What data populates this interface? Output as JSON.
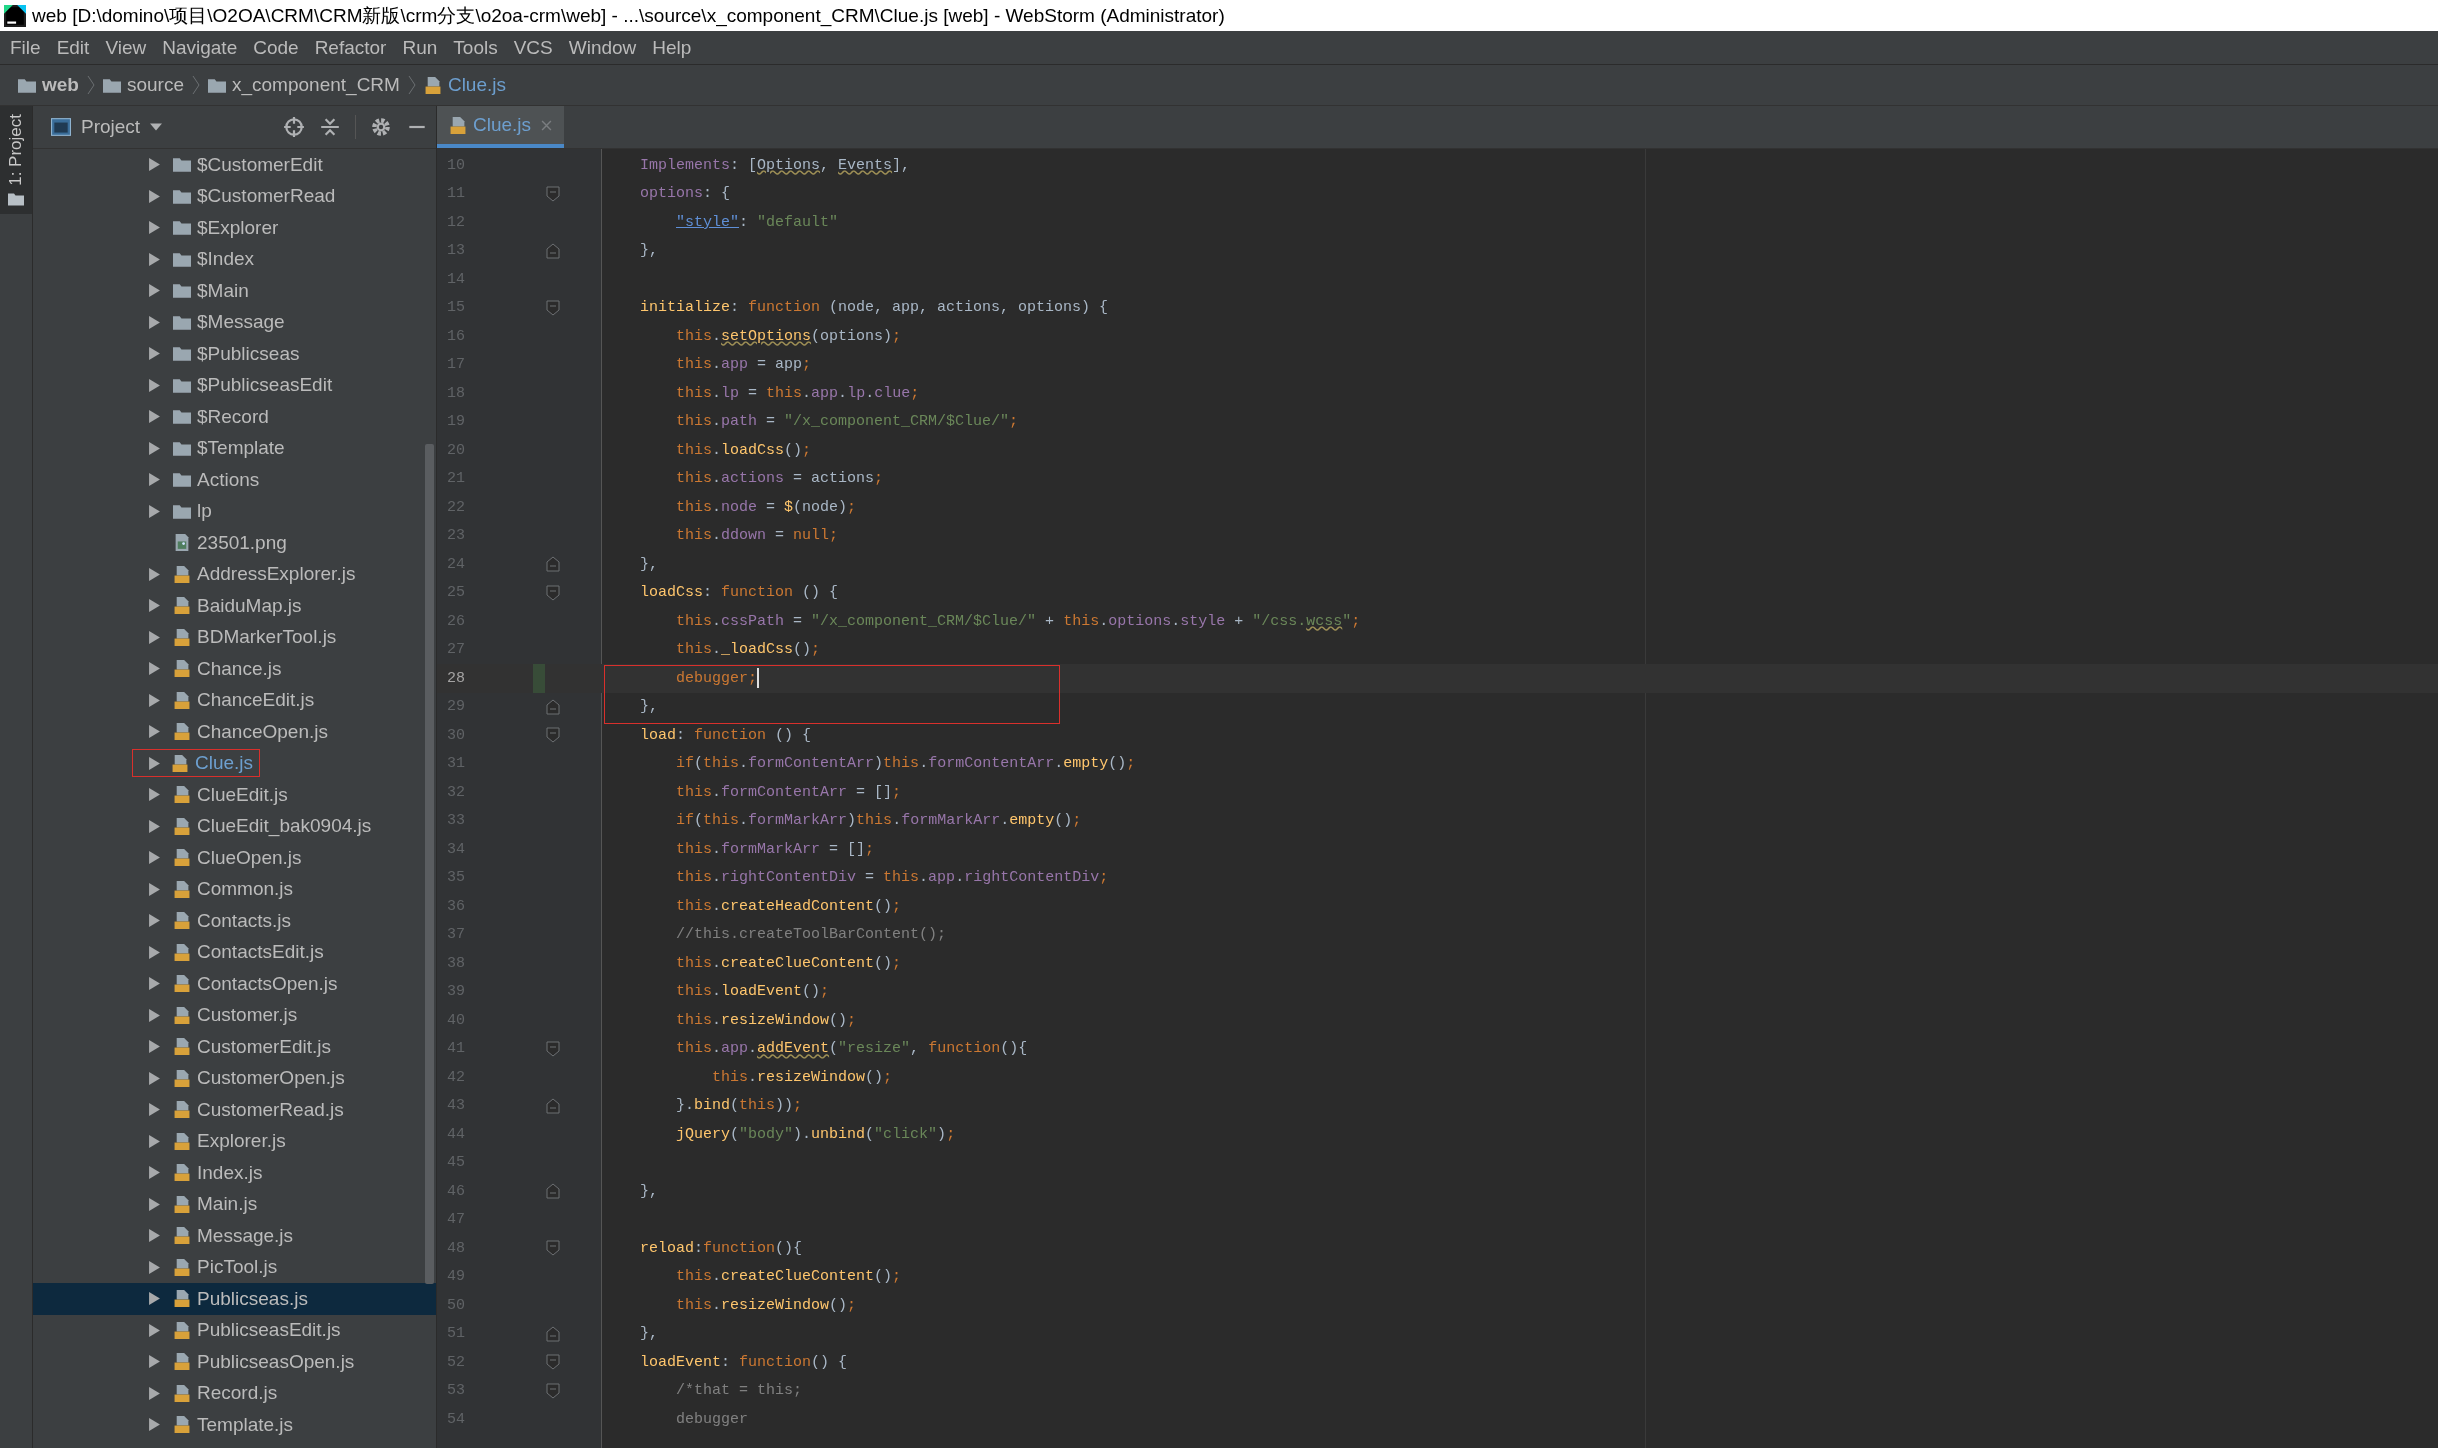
{
  "window": {
    "title": "web [D:\\domino\\项目\\O2OA\\CRM\\CRM新版\\crm分支\\o2oa-crm\\web] - ...\\source\\x_component_CRM\\Clue.js [web] - WebStorm (Administrator)"
  },
  "menu": [
    "File",
    "Edit",
    "View",
    "Navigate",
    "Code",
    "Refactor",
    "Run",
    "Tools",
    "VCS",
    "Window",
    "Help"
  ],
  "breadcrumb": [
    {
      "label": "web",
      "kind": "folder"
    },
    {
      "label": "source",
      "kind": "folder"
    },
    {
      "label": "x_component_CRM",
      "kind": "folder"
    },
    {
      "label": "Clue.js",
      "kind": "js"
    }
  ],
  "side_stripe": {
    "label": "1: Project"
  },
  "project_panel": {
    "title": "Project",
    "items": [
      {
        "label": "$CustomerEdit",
        "kind": "folder",
        "expandable": true,
        "selected": false,
        "open": false,
        "boxed": false
      },
      {
        "label": "$CustomerRead",
        "kind": "folder",
        "expandable": true,
        "selected": false,
        "open": false,
        "boxed": false
      },
      {
        "label": "$Explorer",
        "kind": "folder",
        "expandable": true,
        "selected": false,
        "open": false,
        "boxed": false
      },
      {
        "label": "$Index",
        "kind": "folder",
        "expandable": true,
        "selected": false,
        "open": false,
        "boxed": false
      },
      {
        "label": "$Main",
        "kind": "folder",
        "expandable": true,
        "selected": false,
        "open": false,
        "boxed": false
      },
      {
        "label": "$Message",
        "kind": "folder",
        "expandable": true,
        "selected": false,
        "open": false,
        "boxed": false
      },
      {
        "label": "$Publicseas",
        "kind": "folder",
        "expandable": true,
        "selected": false,
        "open": false,
        "boxed": false
      },
      {
        "label": "$PublicseasEdit",
        "kind": "folder",
        "expandable": true,
        "selected": false,
        "open": false,
        "boxed": false
      },
      {
        "label": "$Record",
        "kind": "folder",
        "expandable": true,
        "selected": false,
        "open": false,
        "boxed": false
      },
      {
        "label": "$Template",
        "kind": "folder",
        "expandable": true,
        "selected": false,
        "open": false,
        "boxed": false
      },
      {
        "label": "Actions",
        "kind": "folder",
        "expandable": true,
        "selected": false,
        "open": false,
        "boxed": false
      },
      {
        "label": "lp",
        "kind": "folder",
        "expandable": true,
        "selected": false,
        "open": false,
        "boxed": false
      },
      {
        "label": "23501.png",
        "kind": "image",
        "expandable": false,
        "selected": false,
        "open": false,
        "boxed": false
      },
      {
        "label": "AddressExplorer.js",
        "kind": "js",
        "expandable": true,
        "selected": false,
        "open": false,
        "boxed": false
      },
      {
        "label": "BaiduMap.js",
        "kind": "js",
        "expandable": true,
        "selected": false,
        "open": false,
        "boxed": false
      },
      {
        "label": "BDMarkerTool.js",
        "kind": "js",
        "expandable": true,
        "selected": false,
        "open": false,
        "boxed": false
      },
      {
        "label": "Chance.js",
        "kind": "js",
        "expandable": true,
        "selected": false,
        "open": false,
        "boxed": false
      },
      {
        "label": "ChanceEdit.js",
        "kind": "js",
        "expandable": true,
        "selected": false,
        "open": false,
        "boxed": false
      },
      {
        "label": "ChanceOpen.js",
        "kind": "js",
        "expandable": true,
        "selected": false,
        "open": false,
        "boxed": false
      },
      {
        "label": "Clue.js",
        "kind": "js",
        "expandable": true,
        "selected": false,
        "open": true,
        "boxed": true
      },
      {
        "label": "ClueEdit.js",
        "kind": "js",
        "expandable": true,
        "selected": false,
        "open": false,
        "boxed": false
      },
      {
        "label": "ClueEdit_bak0904.js",
        "kind": "js",
        "expandable": true,
        "selected": false,
        "open": false,
        "boxed": false
      },
      {
        "label": "ClueOpen.js",
        "kind": "js",
        "expandable": true,
        "selected": false,
        "open": false,
        "boxed": false
      },
      {
        "label": "Common.js",
        "kind": "js",
        "expandable": true,
        "selected": false,
        "open": false,
        "boxed": false
      },
      {
        "label": "Contacts.js",
        "kind": "js",
        "expandable": true,
        "selected": false,
        "open": false,
        "boxed": false
      },
      {
        "label": "ContactsEdit.js",
        "kind": "js",
        "expandable": true,
        "selected": false,
        "open": false,
        "boxed": false
      },
      {
        "label": "ContactsOpen.js",
        "kind": "js",
        "expandable": true,
        "selected": false,
        "open": false,
        "boxed": false
      },
      {
        "label": "Customer.js",
        "kind": "js",
        "expandable": true,
        "selected": false,
        "open": false,
        "boxed": false
      },
      {
        "label": "CustomerEdit.js",
        "kind": "js",
        "expandable": true,
        "selected": false,
        "open": false,
        "boxed": false
      },
      {
        "label": "CustomerOpen.js",
        "kind": "js",
        "expandable": true,
        "selected": false,
        "open": false,
        "boxed": false
      },
      {
        "label": "CustomerRead.js",
        "kind": "js",
        "expandable": true,
        "selected": false,
        "open": false,
        "boxed": false
      },
      {
        "label": "Explorer.js",
        "kind": "js",
        "expandable": true,
        "selected": false,
        "open": false,
        "boxed": false
      },
      {
        "label": "Index.js",
        "kind": "js",
        "expandable": true,
        "selected": false,
        "open": false,
        "boxed": false
      },
      {
        "label": "Main.js",
        "kind": "js",
        "expandable": true,
        "selected": false,
        "open": false,
        "boxed": false
      },
      {
        "label": "Message.js",
        "kind": "js",
        "expandable": true,
        "selected": false,
        "open": false,
        "boxed": false
      },
      {
        "label": "PicTool.js",
        "kind": "js",
        "expandable": true,
        "selected": false,
        "open": false,
        "boxed": false
      },
      {
        "label": "Publicseas.js",
        "kind": "js",
        "expandable": true,
        "selected": true,
        "open": false,
        "boxed": false
      },
      {
        "label": "PublicseasEdit.js",
        "kind": "js",
        "expandable": true,
        "selected": false,
        "open": false,
        "boxed": false
      },
      {
        "label": "PublicseasOpen.js",
        "kind": "js",
        "expandable": true,
        "selected": false,
        "open": false,
        "boxed": false
      },
      {
        "label": "Record.js",
        "kind": "js",
        "expandable": true,
        "selected": false,
        "open": false,
        "boxed": false
      },
      {
        "label": "Template.js",
        "kind": "js",
        "expandable": true,
        "selected": false,
        "open": false,
        "boxed": false
      }
    ]
  },
  "tabs": [
    {
      "label": "Clue.js",
      "selected": true
    }
  ],
  "editor": {
    "lines": [
      {
        "n": "10",
        "kind": "top",
        "current": false,
        "boxed": false,
        "fold_start": false,
        "fold_end": false,
        "segs": [
          {
            "kind": "p",
            "text": "Implements"
          },
          {
            "kind": "t",
            "text": ": ["
          },
          {
            "kind": "tw",
            "text": "Options"
          },
          {
            "kind": "t",
            "text": ", "
          },
          {
            "kind": "tw",
            "text": "Events"
          },
          {
            "kind": "t",
            "text": "],"
          }
        ]
      },
      {
        "n": "11",
        "kind": "top",
        "current": false,
        "boxed": false,
        "fold_start": true,
        "fold_end": false,
        "segs": [
          {
            "kind": "p",
            "text": "options"
          },
          {
            "kind": "t",
            "text": ": {"
          }
        ]
      },
      {
        "n": "12",
        "kind": "body",
        "current": false,
        "boxed": false,
        "fold_start": false,
        "fold_end": false,
        "segs": [
          {
            "kind": "L",
            "text": "\"style\""
          },
          {
            "kind": "t",
            "text": ": "
          },
          {
            "kind": "s",
            "text": "\"default\""
          }
        ]
      },
      {
        "n": "13",
        "kind": "top",
        "current": false,
        "boxed": false,
        "fold_start": false,
        "fold_end": true,
        "segs": [
          {
            "kind": "t",
            "text": "},"
          }
        ]
      },
      {
        "n": "14",
        "current": false,
        "boxed": false,
        "fold_start": false,
        "fold_end": false
      },
      {
        "n": "15",
        "kind": "top",
        "current": false,
        "boxed": false,
        "fold_start": true,
        "fold_end": false,
        "segs": [
          {
            "kind": "f",
            "text": "initialize"
          },
          {
            "kind": "t",
            "text": ": "
          },
          {
            "kind": "k",
            "text": "function"
          },
          {
            "kind": "t",
            "text": " (node, app, actions, options) {"
          }
        ]
      },
      {
        "n": "16",
        "kind": "body",
        "current": false,
        "boxed": false,
        "fold_start": false,
        "fold_end": false,
        "segs": [
          {
            "kind": "k",
            "text": "this"
          },
          {
            "kind": "t",
            "text": "."
          },
          {
            "kind": "fw",
            "text": "setOptions"
          },
          {
            "kind": "t",
            "text": "(options)"
          },
          {
            "kind": "k",
            "text": ";"
          }
        ]
      },
      {
        "n": "17",
        "kind": "body",
        "current": false,
        "boxed": false,
        "fold_start": false,
        "fold_end": false,
        "segs": [
          {
            "kind": "k",
            "text": "this"
          },
          {
            "kind": "t",
            "text": "."
          },
          {
            "kind": "p",
            "text": "app"
          },
          {
            "kind": "t",
            "text": " = app"
          },
          {
            "kind": "k",
            "text": ";"
          }
        ]
      },
      {
        "n": "18",
        "kind": "body",
        "current": false,
        "boxed": false,
        "fold_start": false,
        "fold_end": false,
        "segs": [
          {
            "kind": "k",
            "text": "this"
          },
          {
            "kind": "t",
            "text": "."
          },
          {
            "kind": "p",
            "text": "lp"
          },
          {
            "kind": "t",
            "text": " = "
          },
          {
            "kind": "k",
            "text": "this"
          },
          {
            "kind": "t",
            "text": "."
          },
          {
            "kind": "p",
            "text": "app"
          },
          {
            "kind": "t",
            "text": "."
          },
          {
            "kind": "p",
            "text": "lp"
          },
          {
            "kind": "t",
            "text": "."
          },
          {
            "kind": "p",
            "text": "clue"
          },
          {
            "kind": "k",
            "text": ";"
          }
        ]
      },
      {
        "n": "19",
        "kind": "body",
        "current": false,
        "boxed": false,
        "fold_start": false,
        "fold_end": false,
        "segs": [
          {
            "kind": "k",
            "text": "this"
          },
          {
            "kind": "t",
            "text": "."
          },
          {
            "kind": "p",
            "text": "path"
          },
          {
            "kind": "t",
            "text": " = "
          },
          {
            "kind": "s",
            "text": "\"/x_component_CRM/$Clue/\""
          },
          {
            "kind": "k",
            "text": ";"
          }
        ]
      },
      {
        "n": "20",
        "kind": "body",
        "current": false,
        "boxed": false,
        "fold_start": false,
        "fold_end": false,
        "segs": [
          {
            "kind": "k",
            "text": "this"
          },
          {
            "kind": "t",
            "text": "."
          },
          {
            "kind": "f",
            "text": "loadCss"
          },
          {
            "kind": "t",
            "text": "()"
          },
          {
            "kind": "k",
            "text": ";"
          }
        ]
      },
      {
        "n": "21",
        "kind": "body",
        "current": false,
        "boxed": false,
        "fold_start": false,
        "fold_end": false,
        "segs": [
          {
            "kind": "k",
            "text": "this"
          },
          {
            "kind": "t",
            "text": "."
          },
          {
            "kind": "p",
            "text": "actions"
          },
          {
            "kind": "t",
            "text": " = actions"
          },
          {
            "kind": "k",
            "text": ";"
          }
        ]
      },
      {
        "n": "22",
        "kind": "body",
        "current": false,
        "boxed": false,
        "fold_start": false,
        "fold_end": false,
        "segs": [
          {
            "kind": "k",
            "text": "this"
          },
          {
            "kind": "t",
            "text": "."
          },
          {
            "kind": "p",
            "text": "node"
          },
          {
            "kind": "t",
            "text": " = "
          },
          {
            "kind": "f",
            "text": "$"
          },
          {
            "kind": "t",
            "text": "(node)"
          },
          {
            "kind": "k",
            "text": ";"
          }
        ]
      },
      {
        "n": "23",
        "kind": "body",
        "current": false,
        "boxed": false,
        "fold_start": false,
        "fold_end": false,
        "segs": [
          {
            "kind": "k",
            "text": "this"
          },
          {
            "kind": "t",
            "text": "."
          },
          {
            "kind": "p",
            "text": "ddown"
          },
          {
            "kind": "t",
            "text": " = "
          },
          {
            "kind": "k",
            "text": "null;"
          }
        ]
      },
      {
        "n": "24",
        "kind": "top",
        "current": false,
        "boxed": false,
        "fold_start": false,
        "fold_end": true,
        "segs": [
          {
            "kind": "t",
            "text": "},"
          }
        ]
      },
      {
        "n": "25",
        "kind": "top",
        "current": false,
        "boxed": false,
        "fold_start": true,
        "fold_end": false,
        "segs": [
          {
            "kind": "f",
            "text": "loadCss"
          },
          {
            "kind": "t",
            "text": ": "
          },
          {
            "kind": "k",
            "text": "function"
          },
          {
            "kind": "t",
            "text": " () {"
          }
        ]
      },
      {
        "n": "26",
        "kind": "body",
        "current": false,
        "boxed": false,
        "fold_start": false,
        "fold_end": false,
        "segs": [
          {
            "kind": "k",
            "text": "this"
          },
          {
            "kind": "t",
            "text": "."
          },
          {
            "kind": "p",
            "text": "cssPath"
          },
          {
            "kind": "t",
            "text": " = "
          },
          {
            "kind": "s",
            "text": "\"/x_component_CRM/$Clue/\""
          },
          {
            "kind": "t",
            "text": " + "
          },
          {
            "kind": "k",
            "text": "this"
          },
          {
            "kind": "t",
            "text": "."
          },
          {
            "kind": "p",
            "text": "options"
          },
          {
            "kind": "t",
            "text": "."
          },
          {
            "kind": "p",
            "text": "style"
          },
          {
            "kind": "t",
            "text": " + "
          },
          {
            "kind": "s",
            "text": "\"/css."
          },
          {
            "kind": "sw",
            "text": "wcss"
          },
          {
            "kind": "s",
            "text": "\""
          },
          {
            "kind": "k",
            "text": ";"
          }
        ]
      },
      {
        "n": "27",
        "kind": "body",
        "current": false,
        "boxed": false,
        "fold_start": false,
        "fold_end": false,
        "segs": [
          {
            "kind": "k",
            "text": "this"
          },
          {
            "kind": "t",
            "text": "."
          },
          {
            "kind": "f",
            "text": "_loadCss"
          },
          {
            "kind": "t",
            "text": "()"
          },
          {
            "kind": "k",
            "text": ";"
          }
        ]
      },
      {
        "n": "28",
        "kind": "body",
        "current": true,
        "boxed": true,
        "fold_start": false,
        "fold_end": false,
        "segs": [
          {
            "kind": "k",
            "text": "debugger;"
          }
        ]
      },
      {
        "n": "29",
        "kind": "top",
        "current": false,
        "boxed": true,
        "fold_start": false,
        "fold_end": true,
        "segs": [
          {
            "kind": "t",
            "text": "},"
          }
        ]
      },
      {
        "n": "30",
        "kind": "top",
        "current": false,
        "boxed": false,
        "fold_start": true,
        "fold_end": false,
        "segs": [
          {
            "kind": "f",
            "text": "load"
          },
          {
            "kind": "t",
            "text": ": "
          },
          {
            "kind": "k",
            "text": "function"
          },
          {
            "kind": "t",
            "text": " () {"
          }
        ]
      },
      {
        "n": "31",
        "kind": "body",
        "current": false,
        "boxed": false,
        "fold_start": false,
        "fold_end": false,
        "segs": [
          {
            "kind": "k",
            "text": "if"
          },
          {
            "kind": "t",
            "text": "("
          },
          {
            "kind": "k",
            "text": "this"
          },
          {
            "kind": "t",
            "text": "."
          },
          {
            "kind": "p",
            "text": "formContentArr"
          },
          {
            "kind": "t",
            "text": ")"
          },
          {
            "kind": "k",
            "text": "this"
          },
          {
            "kind": "t",
            "text": "."
          },
          {
            "kind": "p",
            "text": "formContentArr"
          },
          {
            "kind": "t",
            "text": "."
          },
          {
            "kind": "f",
            "text": "empty"
          },
          {
            "kind": "t",
            "text": "()"
          },
          {
            "kind": "k",
            "text": ";"
          }
        ]
      },
      {
        "n": "32",
        "kind": "body",
        "current": false,
        "boxed": false,
        "fold_start": false,
        "fold_end": false,
        "segs": [
          {
            "kind": "k",
            "text": "this"
          },
          {
            "kind": "t",
            "text": "."
          },
          {
            "kind": "p",
            "text": "formContentArr"
          },
          {
            "kind": "t",
            "text": " = []"
          },
          {
            "kind": "k",
            "text": ";"
          }
        ]
      },
      {
        "n": "33",
        "kind": "body",
        "current": false,
        "boxed": false,
        "fold_start": false,
        "fold_end": false,
        "segs": [
          {
            "kind": "k",
            "text": "if"
          },
          {
            "kind": "t",
            "text": "("
          },
          {
            "kind": "k",
            "text": "this"
          },
          {
            "kind": "t",
            "text": "."
          },
          {
            "kind": "p",
            "text": "formMarkArr"
          },
          {
            "kind": "t",
            "text": ")"
          },
          {
            "kind": "k",
            "text": "this"
          },
          {
            "kind": "t",
            "text": "."
          },
          {
            "kind": "p",
            "text": "formMarkArr"
          },
          {
            "kind": "t",
            "text": "."
          },
          {
            "kind": "f",
            "text": "empty"
          },
          {
            "kind": "t",
            "text": "()"
          },
          {
            "kind": "k",
            "text": ";"
          }
        ]
      },
      {
        "n": "34",
        "kind": "body",
        "current": false,
        "boxed": false,
        "fold_start": false,
        "fold_end": false,
        "segs": [
          {
            "kind": "k",
            "text": "this"
          },
          {
            "kind": "t",
            "text": "."
          },
          {
            "kind": "p",
            "text": "formMarkArr"
          },
          {
            "kind": "t",
            "text": " = []"
          },
          {
            "kind": "k",
            "text": ";"
          }
        ]
      },
      {
        "n": "35",
        "kind": "body",
        "current": false,
        "boxed": false,
        "fold_start": false,
        "fold_end": false,
        "segs": [
          {
            "kind": "k",
            "text": "this"
          },
          {
            "kind": "t",
            "text": "."
          },
          {
            "kind": "p",
            "text": "rightContentDiv"
          },
          {
            "kind": "t",
            "text": " = "
          },
          {
            "kind": "k",
            "text": "this"
          },
          {
            "kind": "t",
            "text": "."
          },
          {
            "kind": "p",
            "text": "app"
          },
          {
            "kind": "t",
            "text": "."
          },
          {
            "kind": "p",
            "text": "rightContentDiv"
          },
          {
            "kind": "k",
            "text": ";"
          }
        ]
      },
      {
        "n": "36",
        "kind": "body",
        "current": false,
        "boxed": false,
        "fold_start": false,
        "fold_end": false,
        "segs": [
          {
            "kind": "k",
            "text": "this"
          },
          {
            "kind": "t",
            "text": "."
          },
          {
            "kind": "f",
            "text": "createHeadContent"
          },
          {
            "kind": "t",
            "text": "()"
          },
          {
            "kind": "k",
            "text": ";"
          }
        ]
      },
      {
        "n": "37",
        "kind": "body",
        "current": false,
        "boxed": false,
        "fold_start": false,
        "fold_end": false,
        "segs": [
          {
            "kind": "c",
            "text": "//this.createToolBarContent();"
          }
        ]
      },
      {
        "n": "38",
        "kind": "body",
        "current": false,
        "boxed": false,
        "fold_start": false,
        "fold_end": false,
        "segs": [
          {
            "kind": "k",
            "text": "this"
          },
          {
            "kind": "t",
            "text": "."
          },
          {
            "kind": "f",
            "text": "createClueContent"
          },
          {
            "kind": "t",
            "text": "()"
          },
          {
            "kind": "k",
            "text": ";"
          }
        ]
      },
      {
        "n": "39",
        "kind": "body",
        "current": false,
        "boxed": false,
        "fold_start": false,
        "fold_end": false,
        "segs": [
          {
            "kind": "k",
            "text": "this"
          },
          {
            "kind": "t",
            "text": "."
          },
          {
            "kind": "f",
            "text": "loadEvent"
          },
          {
            "kind": "t",
            "text": "()"
          },
          {
            "kind": "k",
            "text": ";"
          }
        ]
      },
      {
        "n": "40",
        "kind": "body",
        "current": false,
        "boxed": false,
        "fold_start": false,
        "fold_end": false,
        "segs": [
          {
            "kind": "k",
            "text": "this"
          },
          {
            "kind": "t",
            "text": "."
          },
          {
            "kind": "f",
            "text": "resizeWindow"
          },
          {
            "kind": "t",
            "text": "()"
          },
          {
            "kind": "k",
            "text": ";"
          }
        ]
      },
      {
        "n": "41",
        "kind": "body",
        "current": false,
        "boxed": false,
        "fold_start": true,
        "fold_end": false,
        "segs": [
          {
            "kind": "k",
            "text": "this"
          },
          {
            "kind": "t",
            "text": "."
          },
          {
            "kind": "p",
            "text": "app"
          },
          {
            "kind": "t",
            "text": "."
          },
          {
            "kind": "fw",
            "text": "addEvent"
          },
          {
            "kind": "t",
            "text": "("
          },
          {
            "kind": "s",
            "text": "\"resize\""
          },
          {
            "kind": "t",
            "text": ", "
          },
          {
            "kind": "k",
            "text": "function"
          },
          {
            "kind": "t",
            "text": "(){"
          }
        ]
      },
      {
        "n": "42",
        "kind": "deep",
        "current": false,
        "boxed": false,
        "fold_start": false,
        "fold_end": false,
        "segs": [
          {
            "kind": "k",
            "text": "this"
          },
          {
            "kind": "t",
            "text": "."
          },
          {
            "kind": "f",
            "text": "resizeWindow"
          },
          {
            "kind": "t",
            "text": "()"
          },
          {
            "kind": "k",
            "text": ";"
          }
        ]
      },
      {
        "n": "43",
        "kind": "body",
        "current": false,
        "boxed": false,
        "fold_start": false,
        "fold_end": true,
        "segs": [
          {
            "kind": "t",
            "text": "}."
          },
          {
            "kind": "f",
            "text": "bind"
          },
          {
            "kind": "t",
            "text": "("
          },
          {
            "kind": "k",
            "text": "this"
          },
          {
            "kind": "t",
            "text": "))"
          },
          {
            "kind": "k",
            "text": ";"
          }
        ]
      },
      {
        "n": "44",
        "kind": "body",
        "current": false,
        "boxed": false,
        "fold_start": false,
        "fold_end": false,
        "segs": [
          {
            "kind": "f",
            "text": "jQuery"
          },
          {
            "kind": "t",
            "text": "("
          },
          {
            "kind": "s",
            "text": "\"body\""
          },
          {
            "kind": "t",
            "text": ")."
          },
          {
            "kind": "f",
            "text": "unbind"
          },
          {
            "kind": "t",
            "text": "("
          },
          {
            "kind": "s",
            "text": "\"click\""
          },
          {
            "kind": "t",
            "text": ")"
          },
          {
            "kind": "k",
            "text": ";"
          }
        ]
      },
      {
        "n": "45",
        "current": false,
        "boxed": false,
        "fold_start": false,
        "fold_end": false
      },
      {
        "n": "46",
        "kind": "top",
        "current": false,
        "boxed": false,
        "fold_start": false,
        "fold_end": true,
        "segs": [
          {
            "kind": "t",
            "text": "},"
          }
        ]
      },
      {
        "n": "47",
        "current": false,
        "boxed": false,
        "fold_start": false,
        "fold_end": false
      },
      {
        "n": "48",
        "kind": "top",
        "current": false,
        "boxed": false,
        "fold_start": true,
        "fold_end": false,
        "segs": [
          {
            "kind": "f",
            "text": "reload"
          },
          {
            "kind": "t",
            "text": ":"
          },
          {
            "kind": "k",
            "text": "function"
          },
          {
            "kind": "t",
            "text": "(){"
          }
        ]
      },
      {
        "n": "49",
        "kind": "body",
        "current": false,
        "boxed": false,
        "fold_start": false,
        "fold_end": false,
        "segs": [
          {
            "kind": "k",
            "text": "this"
          },
          {
            "kind": "t",
            "text": "."
          },
          {
            "kind": "f",
            "text": "createClueContent"
          },
          {
            "kind": "t",
            "text": "()"
          },
          {
            "kind": "k",
            "text": ";"
          }
        ]
      },
      {
        "n": "50",
        "kind": "body",
        "current": false,
        "boxed": false,
        "fold_start": false,
        "fold_end": false,
        "segs": [
          {
            "kind": "k",
            "text": "this"
          },
          {
            "kind": "t",
            "text": "."
          },
          {
            "kind": "f",
            "text": "resizeWindow"
          },
          {
            "kind": "t",
            "text": "()"
          },
          {
            "kind": "k",
            "text": ";"
          }
        ]
      },
      {
        "n": "51",
        "kind": "top",
        "current": false,
        "boxed": false,
        "fold_start": false,
        "fold_end": true,
        "segs": [
          {
            "kind": "t",
            "text": "},"
          }
        ]
      },
      {
        "n": "52",
        "kind": "top",
        "current": false,
        "boxed": false,
        "fold_start": true,
        "fold_end": false,
        "segs": [
          {
            "kind": "f",
            "text": "loadEvent"
          },
          {
            "kind": "t",
            "text": ": "
          },
          {
            "kind": "k",
            "text": "function"
          },
          {
            "kind": "t",
            "text": "() {"
          }
        ]
      },
      {
        "n": "53",
        "kind": "body",
        "current": false,
        "boxed": false,
        "fold_start": true,
        "fold_end": false,
        "segs": [
          {
            "kind": "c",
            "text": "/*that = this;"
          }
        ]
      },
      {
        "n": "54",
        "kind": "body",
        "current": false,
        "boxed": false,
        "fold_start": false,
        "fold_end": false,
        "segs": [
          {
            "kind": "c",
            "text": "debugger"
          }
        ]
      }
    ]
  }
}
